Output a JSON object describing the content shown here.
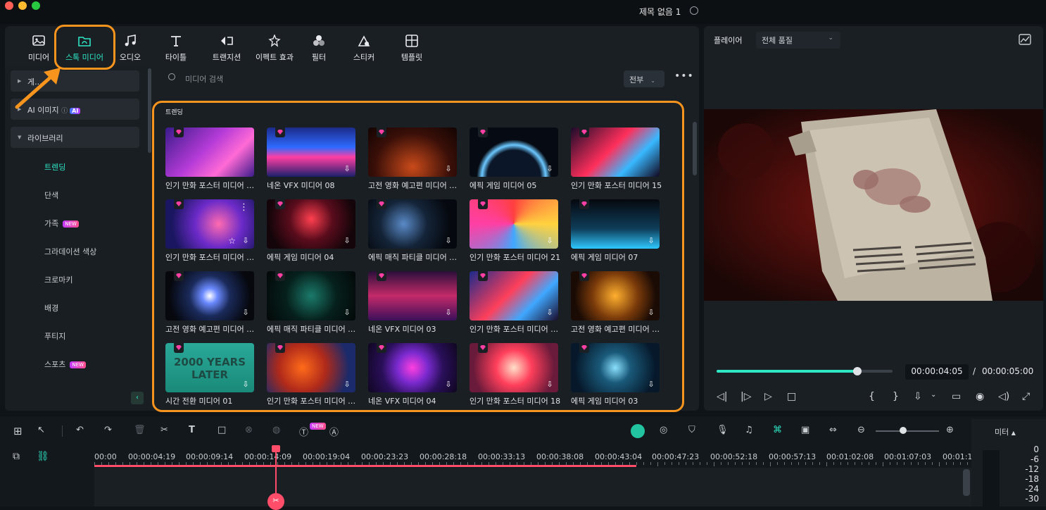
{
  "window": {
    "title": "제목 없음 1"
  },
  "tabs": [
    {
      "label": "미디어",
      "icon": "media-icon"
    },
    {
      "label": "스톡 미디어",
      "icon": "stock-media-icon",
      "active": true
    },
    {
      "label": "오디오",
      "icon": "audio-icon"
    },
    {
      "label": "타이틀",
      "icon": "title-icon"
    },
    {
      "label": "트랜지션",
      "icon": "transition-icon"
    },
    {
      "label": "이펙트 효과",
      "icon": "effects-icon"
    },
    {
      "label": "필터",
      "icon": "filter-icon"
    },
    {
      "label": "스티커",
      "icon": "sticker-icon"
    },
    {
      "label": "템플릿",
      "icon": "template-icon"
    }
  ],
  "sidebar": {
    "groups": [
      {
        "label": "게..."
      },
      {
        "label": "AI 이미지",
        "badge": "AI"
      },
      {
        "label": "라이브러리"
      }
    ],
    "items": [
      {
        "label": "트렌딩",
        "active": true
      },
      {
        "label": "단색"
      },
      {
        "label": "가족",
        "badge": "NEW"
      },
      {
        "label": "그라데이션 색상"
      },
      {
        "label": "크로마키"
      },
      {
        "label": "배경"
      },
      {
        "label": "푸티지"
      },
      {
        "label": "스포츠",
        "badge": "NEW"
      }
    ]
  },
  "search": {
    "placeholder": "미디어 검색",
    "filter": "전부"
  },
  "section_title": "트렌딩",
  "media": [
    {
      "caption": "인기 만화 포스터 미디어 …"
    },
    {
      "caption": "네온 VFX 미디어 08"
    },
    {
      "caption": "고전 영화 예고편 미디어 …"
    },
    {
      "caption": "에픽 게임 미디어 05"
    },
    {
      "caption": "인기 만화 포스터 미디어 15"
    },
    {
      "caption": "인기 만화 포스터 미디어 …"
    },
    {
      "caption": "에픽 게임 미디어 04"
    },
    {
      "caption": "에픽 매직 파티클 미디어 …"
    },
    {
      "caption": "인기 만화 포스터 미디어 21"
    },
    {
      "caption": "에픽 게임 미디어 07"
    },
    {
      "caption": "고전 영화 예고편 미디어 …"
    },
    {
      "caption": "에픽 매직 파티클 미디어 …"
    },
    {
      "caption": "네온 VFX 미디어 03"
    },
    {
      "caption": "인기 만화 포스터 미디어 …"
    },
    {
      "caption": "고전 영화 예고편 미디어 …"
    },
    {
      "caption": "시간 전환 미디어 01",
      "thumb_text": "2000 YEARS LATER"
    },
    {
      "caption": "인기 만화 포스터 미디어 …"
    },
    {
      "caption": "네온 VFX 미디어 04"
    },
    {
      "caption": "인기 만화 포스터 미디어 18"
    },
    {
      "caption": "에픽 게임 미디어 03"
    }
  ],
  "player": {
    "label": "플레이어",
    "quality": "전체 품질",
    "current_time": "00:00:04:05",
    "separator": "/",
    "total_time": "00:00:05:00",
    "progress": 0.8
  },
  "timeline": {
    "ruler": [
      "00:00",
      "00:00:04:19",
      "00:00:09:14",
      "00:00:14:09",
      "00:00:19:04",
      "00:00:23:23",
      "00:00:28:18",
      "00:00:33:13",
      "00:00:38:08",
      "00:00:43:04",
      "00:00:47:23",
      "00:00:52:18",
      "00:00:57:13",
      "00:01:02:08",
      "00:01:07:03",
      "00:01:1"
    ],
    "meter_label": "미터",
    "meter_scale": [
      "0",
      "-6",
      "-12",
      "-18",
      "-24",
      "-30"
    ],
    "new_badge": "NEW"
  },
  "colors": {
    "accent": "#2ee5c4",
    "highlight": "#f7941d",
    "playhead": "#ff4d6a"
  }
}
